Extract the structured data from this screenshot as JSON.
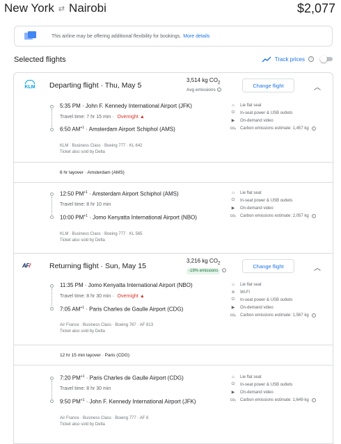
{
  "header": {
    "origin": "New York",
    "destination": "Nairobi",
    "price": "$2,077"
  },
  "banner": {
    "text": "This airline may be offering additional flexibility for bookings.",
    "link": "More details"
  },
  "selected": {
    "title": "Selected flights",
    "track_label": "Track prices"
  },
  "departing": {
    "title": "Departing flight · Thu, May 5",
    "co2": "3,514 kg CO",
    "co2_sub": "2",
    "co2_label": "Avg emissions",
    "change_label": "Change flight",
    "legs": [
      {
        "dep_time": "5:35 PM",
        "dep_airport": "John F. Kennedy International Airport (JFK)",
        "travel": "Travel time: 7 hr 15 min",
        "overnight": "Overnight",
        "arr_time": "6:50 AM",
        "arr_sup": "+1",
        "arr_airport": "Amsterdam Airport Schiphol (AMS)",
        "details": "KLM · Business Class · Boeing 777 · KL 642",
        "sold_by": "Ticket also sold by Delta",
        "amenities": [
          "Lie flat seat",
          "In-seat power & USB outlets",
          "On-demand video",
          "Carbon emissions estimate: 1,457 kg"
        ]
      },
      {
        "dep_time": "12:50 PM",
        "dep_sup": "+1",
        "dep_airport": "Amsterdam Airport Schiphol (AMS)",
        "travel": "Travel time: 8 hr 10 min",
        "arr_time": "10:00 PM",
        "arr_sup": "+1",
        "arr_airport": "Jomo Kenyatta International Airport (NBO)",
        "details": "KLM · Business Class · Boeing 777 · KL 565",
        "sold_by": "Ticket also sold by Delta",
        "amenities": [
          "Lie flat seat",
          "In-seat power & USB outlets",
          "On-demand video",
          "Carbon emissions estimate: 2,057 kg"
        ]
      }
    ],
    "layover": "6 hr layover · Amsterdam (AMS)"
  },
  "returning": {
    "title": "Returning flight · Sun, May 15",
    "co2": "3,216 kg CO",
    "co2_sub": "2",
    "co2_badge": "-19% emissions",
    "change_label": "Change flight",
    "legs": [
      {
        "dep_time": "11:35 PM",
        "dep_airport": "Jomo Kenyatta International Airport (NBO)",
        "travel": "Travel time: 8 hr 30 min",
        "overnight": "Overnight",
        "arr_time": "7:05 AM",
        "arr_sup": "+1",
        "arr_airport": "Paris Charles de Gaulle Airport (CDG)",
        "details": "Air France · Business Class · Boeing 787 · AF 813",
        "sold_by": "Ticket also sold by Delta",
        "amenities": [
          "Lie flat seat",
          "Wi-Fi",
          "In-seat power & USB outlets",
          "On-demand video",
          "Carbon emissions estimate: 1,567 kg"
        ]
      },
      {
        "dep_time": "7:20 PM",
        "dep_sup": "+1",
        "dep_airport": "Paris Charles de Gaulle Airport (CDG)",
        "travel": "Travel time: 8 hr 30 min",
        "arr_time": "9:50 PM",
        "arr_sup": "+1",
        "arr_airport": "John F. Kennedy International Airport (JFK)",
        "details": "Air France · Business Class · Boeing 777 · AF 8",
        "sold_by": "Ticket also sold by Delta",
        "amenities": [
          "Lie flat seat",
          "In-seat power & USB outlets",
          "On-demand video",
          "Carbon emissions estimate: 1,649 kg"
        ]
      }
    ],
    "layover": "12 hr 15 min layover · Paris (CDG)"
  },
  "logos": {
    "klm": "KLM",
    "af_main": "AF",
    "af_slash": "/"
  },
  "colors": {
    "link": "#1a73e8",
    "warning": "#d93025",
    "badge_bg": "#e6f4ea",
    "badge_text": "#137333"
  },
  "icons": {
    "seat": "seat-icon",
    "wifi": "wifi-icon",
    "power": "power-plug-icon",
    "video": "video-icon",
    "co2": "co2-icon"
  }
}
